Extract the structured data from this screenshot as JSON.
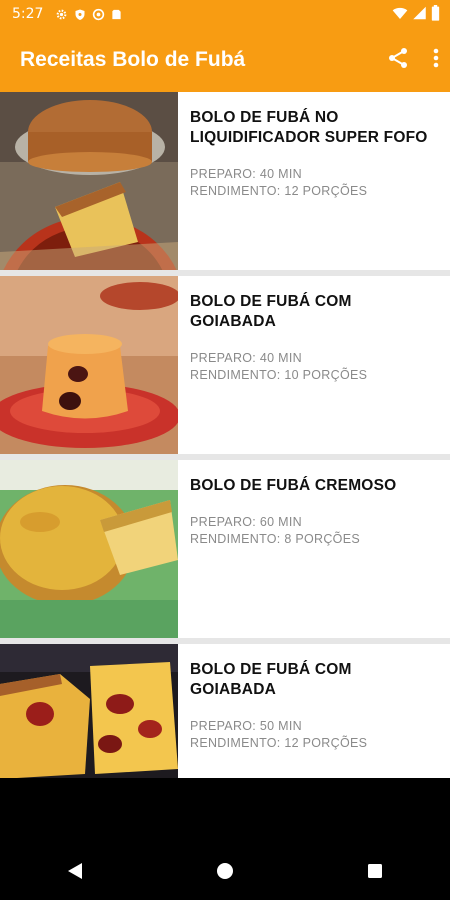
{
  "status_bar": {
    "time": "5:27",
    "icons_left": [
      "gear-icon",
      "shield-icon",
      "at-icon",
      "sd-card-icon"
    ],
    "icons_right": [
      "wifi-icon",
      "signal-icon",
      "battery-icon"
    ]
  },
  "app_bar": {
    "title": "Receitas Bolo de Fubá",
    "actions": [
      "share-icon",
      "more-vert-icon"
    ],
    "color": "#F89C12"
  },
  "recipes": [
    {
      "title": "BOLO DE FUBÁ NO LIQUIDIFICADOR SUPER FOFO",
      "preparo": "PREPARO: 40 MIN",
      "rendimento": "RENDIMENTO: 12 PORÇÕES"
    },
    {
      "title": "BOLO DE FUBÁ COM GOIABADA",
      "preparo": "PREPARO: 40 MIN",
      "rendimento": "RENDIMENTO: 10 PORÇÕES"
    },
    {
      "title": "BOLO DE FUBÁ CREMOSO",
      "preparo": "PREPARO: 60 MIN",
      "rendimento": "RENDIMENTO: 8 PORÇÕES"
    },
    {
      "title": "BOLO DE FUBÁ COM GOIABADA",
      "preparo": "PREPARO: 50 MIN",
      "rendimento": "RENDIMENTO: 12 PORÇÕES"
    }
  ],
  "nav_bar": {
    "buttons": [
      "back-icon",
      "home-icon",
      "recents-icon"
    ]
  }
}
